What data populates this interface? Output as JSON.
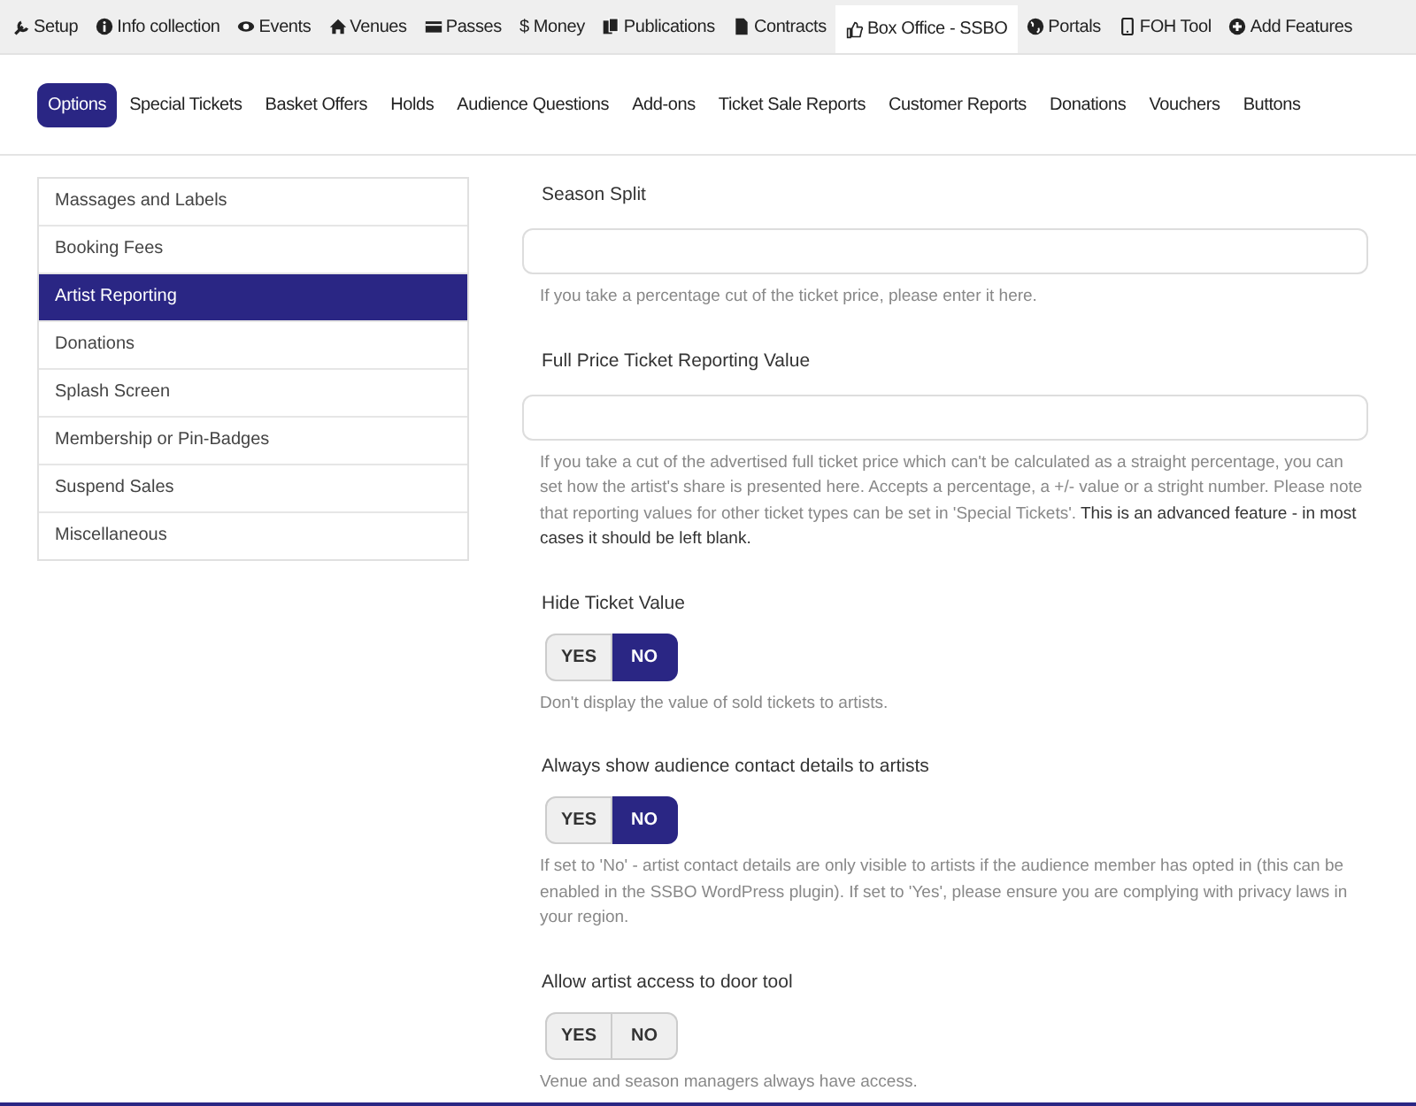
{
  "top_nav": [
    {
      "label": "Setup",
      "selected": false
    },
    {
      "label": "Info collection",
      "selected": false
    },
    {
      "label": "Events",
      "selected": false
    },
    {
      "label": "Venues",
      "selected": false
    },
    {
      "label": "Passes",
      "selected": false
    },
    {
      "label": "$ Money",
      "selected": false
    },
    {
      "label": "Publications",
      "selected": false
    },
    {
      "label": "Contracts",
      "selected": false
    },
    {
      "label": "Box Office - SSBO",
      "selected": true
    },
    {
      "label": "Portals",
      "selected": false
    },
    {
      "label": "FOH Tool",
      "selected": false
    },
    {
      "label": "Add Features",
      "selected": false
    }
  ],
  "sub_tabs": [
    {
      "label": "Options",
      "selected": true
    },
    {
      "label": "Special Tickets",
      "selected": false
    },
    {
      "label": "Basket Offers",
      "selected": false
    },
    {
      "label": "Holds",
      "selected": false
    },
    {
      "label": "Audience Questions",
      "selected": false
    },
    {
      "label": "Add-ons",
      "selected": false
    },
    {
      "label": "Ticket Sale Reports",
      "selected": false
    },
    {
      "label": "Customer Reports",
      "selected": false
    },
    {
      "label": "Donations",
      "selected": false
    },
    {
      "label": "Vouchers",
      "selected": false
    },
    {
      "label": "Buttons",
      "selected": false
    }
  ],
  "sidebar": {
    "items": [
      {
        "label": "Massages and Labels",
        "selected": false
      },
      {
        "label": "Booking Fees",
        "selected": false
      },
      {
        "label": "Artist Reporting",
        "selected": true
      },
      {
        "label": "Donations",
        "selected": false
      },
      {
        "label": "Splash Screen",
        "selected": false
      },
      {
        "label": "Membership or Pin-Badges",
        "selected": false
      },
      {
        "label": "Suspend Sales",
        "selected": false
      },
      {
        "label": "Miscellaneous",
        "selected": false
      }
    ]
  },
  "fields": [
    {
      "kind": "text",
      "label": "Season Split",
      "help": "If you take a percentage cut of the ticket price, please enter it here."
    },
    {
      "kind": "text",
      "label": "Full Price Ticket Reporting Value",
      "help": "If you take a cut of the advertised full ticket price which can't be calculated as a straight percentage, you can set how the artist's share is presented here. Accepts a percentage, a +/- value or a stright number. Please note that reporting values for other ticket types can be set in 'Special Tickets'. **This is an advanced feature - in most cases it should be left blank.**"
    },
    {
      "kind": "toggle",
      "label": "Hide Ticket Value",
      "options": [
        {
          "label": "YES",
          "selected": false
        },
        {
          "label": "NO",
          "selected": true
        }
      ],
      "help": "Don't display the value of sold tickets to artists."
    },
    {
      "kind": "toggle",
      "label": "Always show audience contact details to artists",
      "options": [
        {
          "label": "YES",
          "selected": false
        },
        {
          "label": "NO",
          "selected": true
        }
      ],
      "help": "If set to 'No' - artist contact details are only visible to artists if the audience member has opted in (this can be enabled in the SSBO WordPress plugin). If set to 'Yes', please ensure you are complying with privacy laws in your region."
    },
    {
      "kind": "toggle",
      "label": "Allow artist access to door tool",
      "options": [
        {
          "label": "YES",
          "selected": false
        },
        {
          "label": "NO",
          "selected": false
        }
      ],
      "help": "Venue and season managers always have access."
    }
  ]
}
